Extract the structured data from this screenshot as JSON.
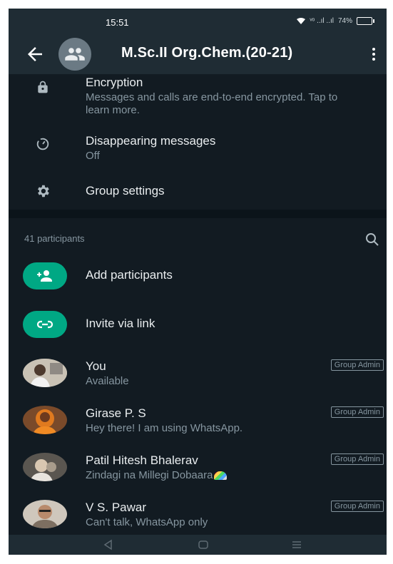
{
  "status_bar": {
    "time": "15:51",
    "signal_text": "ᵛᵒ ..ıl ..ıl",
    "battery": "74%",
    "battery_level": 0.74
  },
  "header": {
    "title": "M.Sc.II Org.Chem.(20-21)"
  },
  "info_rows": [
    {
      "icon": "lock-icon",
      "title": "Encryption",
      "subtitle": "Messages and calls are end-to-end encrypted. Tap to learn more."
    },
    {
      "icon": "timer-icon",
      "title": "Disappearing messages",
      "subtitle": "Off"
    },
    {
      "icon": "gear-icon",
      "title": "Group settings"
    }
  ],
  "participants": {
    "count_label": "41 participants",
    "actions": [
      {
        "icon": "add-person-icon",
        "label": "Add participants"
      },
      {
        "icon": "link-icon",
        "label": "Invite via link"
      }
    ],
    "members": [
      {
        "name": "You",
        "status": "Available",
        "badge": "Group Admin"
      },
      {
        "name": "Girase P. S",
        "status": "Hey there! I am using WhatsApp.",
        "badge": "Group Admin"
      },
      {
        "name": "Patil Hitesh Bhalerav",
        "status": "Zindagi na Millegi Dobaara",
        "badge": "Group Admin"
      },
      {
        "name": "V S. Pawar",
        "status": "Can't talk, WhatsApp only",
        "badge": "Group Admin"
      }
    ]
  },
  "colors": {
    "background": "#121b22",
    "bar": "#1f2c34",
    "accent": "#00a884",
    "text": "#e9edef",
    "muted": "#8696a0"
  }
}
